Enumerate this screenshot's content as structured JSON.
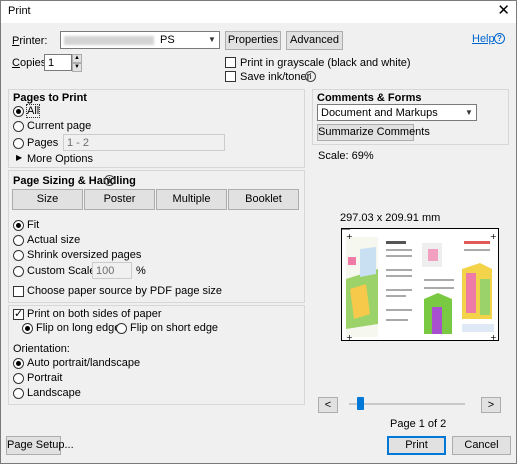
{
  "window": {
    "title": "Print"
  },
  "printer": {
    "label": "Printer:",
    "value_suffix": "PS",
    "properties": "Properties",
    "advanced": "Advanced",
    "help": "Help"
  },
  "copies": {
    "label": "Copies:",
    "value": "1"
  },
  "options": {
    "grayscale": "Print in grayscale (black and white)",
    "save_ink": "Save ink/toner"
  },
  "pages": {
    "heading": "Pages to Print",
    "all": "All",
    "current": "Current page",
    "pages": "Pages",
    "pages_value": "1 - 2",
    "more_options": "More Options"
  },
  "sizing": {
    "heading": "Page Sizing & Handling",
    "buttons": [
      "Size",
      "Poster",
      "Multiple",
      "Booklet"
    ],
    "fit": "Fit",
    "actual": "Actual size",
    "shrink": "Shrink oversized pages",
    "custom": "Custom Scale:",
    "custom_value": "100",
    "percent": "%",
    "paper_source": "Choose paper source by PDF page size"
  },
  "duplex": {
    "both_sides": "Print on both sides of paper",
    "long_edge": "Flip on long edge",
    "short_edge": "Flip on short edge"
  },
  "orientation": {
    "heading": "Orientation:",
    "auto": "Auto portrait/landscape",
    "portrait": "Portrait",
    "landscape": "Landscape"
  },
  "comments": {
    "heading": "Comments & Forms",
    "value": "Document and Markups",
    "summarize": "Summarize Comments"
  },
  "preview": {
    "scale": "Scale:  69%",
    "dimensions": "297.03 x 209.91 mm",
    "page_status": "Page 1 of 2",
    "prev": "<",
    "next": ">",
    "slider_position": 0.0
  },
  "footer": {
    "page_setup": "Page Setup...",
    "print": "Print",
    "cancel": "Cancel"
  },
  "colors": {
    "accent": "#0078d7",
    "link": "#0066cc"
  }
}
